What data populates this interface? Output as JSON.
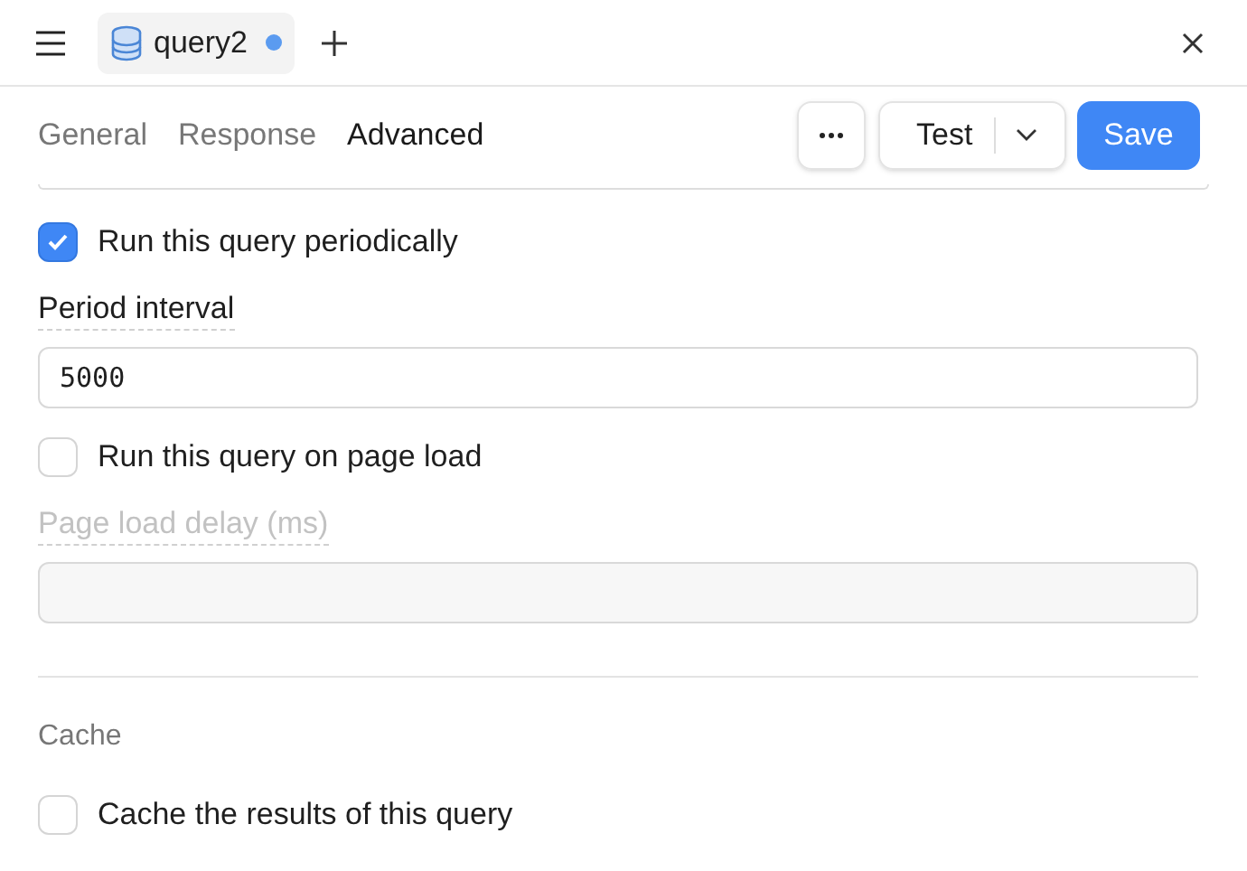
{
  "header": {
    "tab": {
      "title": "query2",
      "unsaved": true
    }
  },
  "tabs": [
    {
      "label": "General",
      "selected": false
    },
    {
      "label": "Response",
      "selected": false
    },
    {
      "label": "Advanced",
      "selected": true
    }
  ],
  "actions": {
    "test": "Test",
    "save": "Save"
  },
  "settings": [
    {
      "kind": "checkbox",
      "label": "Run this query periodically",
      "checked": true
    },
    {
      "kind": "field",
      "label": "Period interval",
      "value": "5000",
      "disabled": false
    },
    {
      "kind": "checkbox",
      "label": "Run this query on page load",
      "checked": false
    },
    {
      "kind": "field",
      "label": "Page load delay (ms)",
      "disabled": true
    },
    {
      "kind": "divider"
    },
    {
      "kind": "heading",
      "label": "Cache"
    },
    {
      "kind": "checkbox",
      "label": "Cache the results of this query",
      "checked": false
    }
  ]
}
